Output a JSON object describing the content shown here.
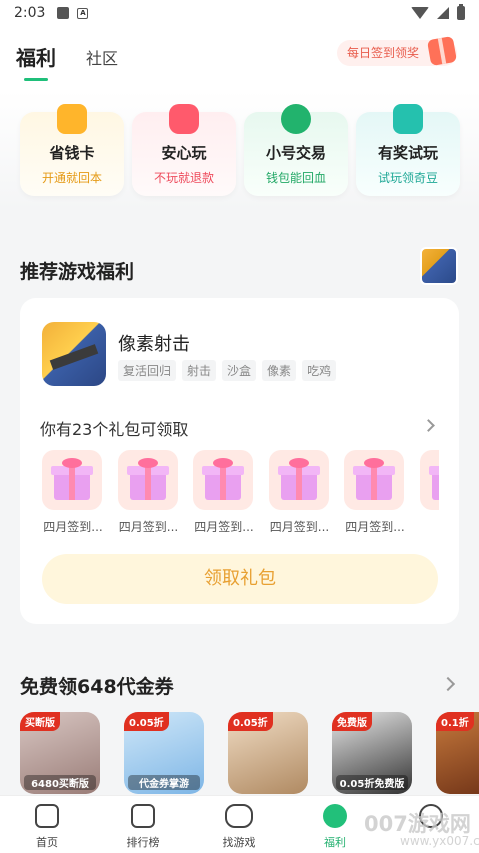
{
  "status_bar": {
    "time": "2:03"
  },
  "header": {
    "tabs": [
      {
        "label": "福利",
        "active": true
      },
      {
        "label": "社区",
        "active": false
      }
    ],
    "checkin_label": "每日签到领奖",
    "accent_color": "#1fbf7a"
  },
  "features": [
    {
      "title": "省钱卡",
      "subtitle": "开通就回本",
      "icon": "wallet-icon"
    },
    {
      "title": "安心玩",
      "subtitle": "不玩就退款",
      "icon": "gamepad-heart-icon"
    },
    {
      "title": "小号交易",
      "subtitle": "钱包能回血",
      "icon": "yuan-coin-icon"
    },
    {
      "title": "有奖试玩",
      "subtitle": "试玩领奇豆",
      "icon": "gift-box-icon"
    }
  ],
  "recommend": {
    "section_title": "推荐游戏福利",
    "game_name": "像素射击",
    "tags": [
      "复活回归",
      "射击",
      "沙盒",
      "像素",
      "吃鸡"
    ],
    "gift_count_text": "你有23个礼包可领取",
    "gifts": [
      {
        "label": "四月签到..."
      },
      {
        "label": "四月签到..."
      },
      {
        "label": "四月签到..."
      },
      {
        "label": "四月签到..."
      },
      {
        "label": "四月签到..."
      },
      {
        "label": "四月"
      }
    ],
    "claim_button": "领取礼包"
  },
  "voucher_section": {
    "title": "免费领648代金券",
    "games": [
      {
        "badge": "买断版",
        "caption": "6480买断版"
      },
      {
        "badge": "0.05折",
        "caption": "代金券掌游"
      },
      {
        "badge": "0.05折",
        "caption": ""
      },
      {
        "badge": "免费版",
        "caption": "0.05折免费版"
      },
      {
        "badge": "0.1折",
        "caption": ""
      }
    ]
  },
  "bottom_nav": [
    {
      "label": "首页",
      "icon": "home-icon",
      "active": false
    },
    {
      "label": "排行榜",
      "icon": "ranking-icon",
      "active": false
    },
    {
      "label": "找游戏",
      "icon": "gamepad-icon",
      "active": false
    },
    {
      "label": "福利",
      "icon": "planet-icon",
      "active": true
    },
    {
      "label": "",
      "icon": "chat-icon",
      "active": false
    }
  ],
  "watermark": {
    "main": "007游戏网",
    "sub": "www.yx007.com"
  }
}
